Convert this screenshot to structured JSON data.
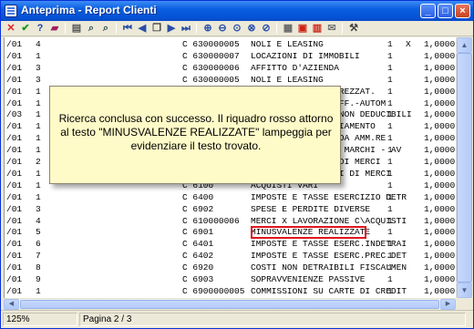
{
  "window": {
    "title": "Anteprima - Report Clienti",
    "buttons": {
      "minimize": "_",
      "maximize": "□",
      "close": "×"
    }
  },
  "toolbar": {
    "icons": [
      "close-icon",
      "check-icon",
      "help-icon",
      "book-icon",
      "page-setup-icon",
      "search-icon",
      "find-next-icon",
      "first-page-icon",
      "previous-page-icon",
      "pages-icon",
      "next-page-icon",
      "last-page-icon",
      "zoom-in-icon",
      "zoom-out-icon",
      "zoom-page-icon",
      "zoom-width-icon",
      "zoom-fit-icon",
      "export-icon",
      "pdf-icon",
      "excel-icon",
      "mail-icon",
      "tools-icon"
    ]
  },
  "rows": [
    {
      "a": "/01",
      "b": "4",
      "c": "C 630000005",
      "d": "NOLI E LEASING",
      "e": "1",
      "f": "X",
      "g": "1,0000"
    },
    {
      "a": "/01",
      "b": "1",
      "c": "C 630000007",
      "d": "LOCAZIONI DI IMMOBILI",
      "e": "1",
      "f": "",
      "g": "1,0000"
    },
    {
      "a": "/01",
      "b": "3",
      "c": "C 630000006",
      "d": "AFFITTO D'AZIENDA",
      "e": "1",
      "f": "",
      "g": "1,0000"
    },
    {
      "a": "/01",
      "b": "3",
      "c": "C 630000005",
      "d": "NOLI E LEASING",
      "e": "1",
      "f": "",
      "g": "1,0000"
    },
    {
      "a": "/01",
      "b": "1",
      "c": "C 630",
      "d": "AMM.TO ORDIN. ATTREZZAT.",
      "e": "1",
      "f": "",
      "g": "1,0000"
    },
    {
      "a": "/01",
      "b": "1",
      "c": "C 640",
      "d": "AMM.TO ORD.-MOB.UFF.-AUTOM",
      "e": "1",
      "f": "",
      "g": "1,0000"
    },
    {
      "a": "/03",
      "b": "1",
      "c": "C 640",
      "d": "ACC.TO SVALUTAZ. NON DEDUCIBILI",
      "e": "1",
      "f": "",
      "g": "1,0000"
    },
    {
      "a": "/01",
      "b": "1",
      "c": "C 640",
      "d": "AMM.TO SPESE AMPLIAMENTO",
      "e": "1",
      "f": "",
      "g": "1,0000"
    },
    {
      "a": "/01",
      "b": "1",
      "c": "C 640",
      "d": "AMM.TO IMMOB. D. DA AMM.RE",
      "e": "1",
      "f": "",
      "g": "1,0000"
    },
    {
      "a": "/01",
      "b": "1",
      "c": "C 640",
      "d": "AMM.TO BREVETTI - MARCHI - AV",
      "e": "1",
      "f": "",
      "g": "1,0000"
    },
    {
      "a": "/01",
      "b": "2",
      "c": "C 640",
      "d": "RIMANENZE FINALI DI MERCI",
      "e": "1",
      "f": "",
      "g": "1,0000"
    },
    {
      "a": "/01",
      "b": "1",
      "c": "C 640",
      "d": "RIMANENZE INIZIALI DI MERCI",
      "e": "1",
      "f": "",
      "g": "1,0000"
    },
    {
      "a": "/01",
      "b": "1",
      "c": "C 6100",
      "d": "ACQUISTI VARI",
      "e": "1",
      "f": "",
      "g": "1,0000"
    },
    {
      "a": "/01",
      "b": "1",
      "c": "C 6400",
      "d": "IMPOSTE E TASSE ESERCIZIO DETR",
      "e": "1",
      "f": "",
      "g": "1,0000"
    },
    {
      "a": "/01",
      "b": "3",
      "c": "C 6902",
      "d": "SPESE E PERDITE DIVERSE",
      "e": "1",
      "f": "",
      "g": "1,0000"
    },
    {
      "a": "/01",
      "b": "4",
      "c": "C 610000006",
      "d": "MERCI X LAVORAZIONE C\\ACQUISTI",
      "e": "1",
      "f": "",
      "g": "1,0000"
    },
    {
      "a": "/01",
      "b": "5",
      "c": "C 6901",
      "d": "MINUSVALENZE REALIZZATE",
      "e": "1",
      "f": "",
      "g": "1,0000"
    },
    {
      "a": "/01",
      "b": "6",
      "c": "C 6401",
      "d": "IMPOSTE E TASSE ESERC.INDETRAI",
      "e": "1",
      "f": "",
      "g": "1,0000"
    },
    {
      "a": "/01",
      "b": "7",
      "c": "C 6402",
      "d": "IMPOSTE E TASSE ESERC.PREC.DET",
      "e": "1",
      "f": "",
      "g": "1,0000"
    },
    {
      "a": "/01",
      "b": "8",
      "c": "C 6920",
      "d": "COSTI NON DETRAIBILI FISCALMEN",
      "e": "1",
      "f": "",
      "g": "1,0000"
    },
    {
      "a": "/01",
      "b": "9",
      "c": "C 6903",
      "d": "SOPRAVVENIENZE PASSIVE",
      "e": "1",
      "f": "",
      "g": "1,0000"
    },
    {
      "a": "/01",
      "b": "1",
      "c": "C 6900000005",
      "d": "COMMISSIONI SU CARTE DI CREDIT",
      "e": "1",
      "f": "",
      "g": "1,0000"
    }
  ],
  "tooltip": {
    "text": "Ricerca conclusa con successo. Il riquadro rosso attorno al testo \"MINUSVALENZE REALIZZATE\" lampeggia per evidenziare il testo trovato."
  },
  "status": {
    "zoom": "125%",
    "page": "Pagina 2 / 3"
  },
  "colors": {
    "highlight": "#e0141e",
    "titlebar": "#0a5fe0",
    "tooltip_bg": "#fffbc8"
  }
}
